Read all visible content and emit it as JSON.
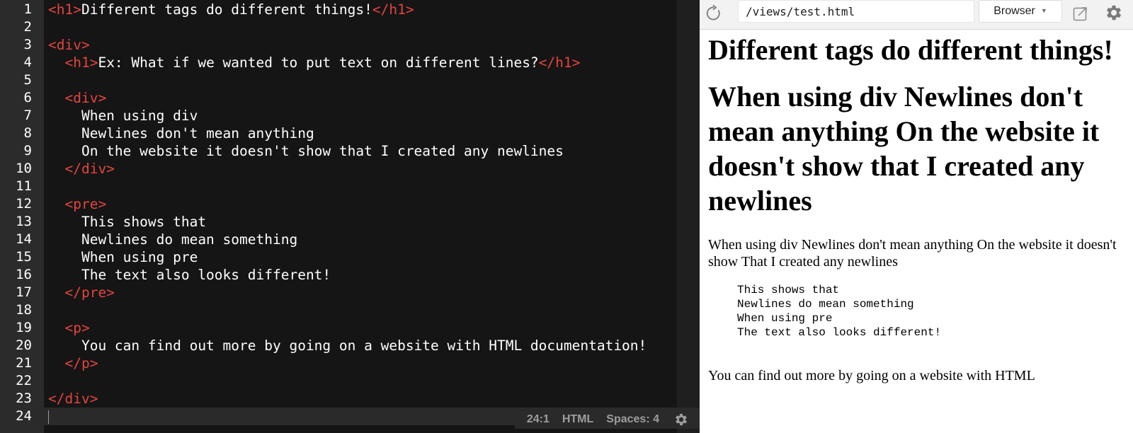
{
  "editor": {
    "lines": [
      {
        "num": "1",
        "parts": [
          [
            "tag",
            "<h1>"
          ],
          [
            "text",
            "Different tags do different things!"
          ],
          [
            "tag",
            "</h1>"
          ]
        ]
      },
      {
        "num": "2",
        "parts": []
      },
      {
        "num": "3",
        "parts": [
          [
            "tag",
            "<div>"
          ]
        ]
      },
      {
        "num": "4",
        "parts": [
          [
            "text",
            "  "
          ],
          [
            "tag",
            "<h1>"
          ],
          [
            "text",
            "Ex: What if we wanted to put text on different lines?"
          ],
          [
            "tag",
            "</h1>"
          ]
        ]
      },
      {
        "num": "5",
        "parts": []
      },
      {
        "num": "6",
        "parts": [
          [
            "text",
            "  "
          ],
          [
            "tag",
            "<div>"
          ]
        ]
      },
      {
        "num": "7",
        "parts": [
          [
            "text",
            "    When using div"
          ]
        ]
      },
      {
        "num": "8",
        "parts": [
          [
            "text",
            "    Newlines don't mean anything"
          ]
        ]
      },
      {
        "num": "9",
        "parts": [
          [
            "text",
            "    On the website it doesn't show that I created any newlines"
          ]
        ]
      },
      {
        "num": "10",
        "parts": [
          [
            "text",
            "  "
          ],
          [
            "tag",
            "</div>"
          ]
        ]
      },
      {
        "num": "11",
        "parts": []
      },
      {
        "num": "12",
        "parts": [
          [
            "text",
            "  "
          ],
          [
            "tag",
            "<pre>"
          ]
        ]
      },
      {
        "num": "13",
        "parts": [
          [
            "text",
            "    This shows that"
          ]
        ]
      },
      {
        "num": "14",
        "parts": [
          [
            "text",
            "    Newlines do mean something"
          ]
        ]
      },
      {
        "num": "15",
        "parts": [
          [
            "text",
            "    When using pre"
          ]
        ]
      },
      {
        "num": "16",
        "parts": [
          [
            "text",
            "    The text also looks different!"
          ]
        ]
      },
      {
        "num": "17",
        "parts": [
          [
            "text",
            "  "
          ],
          [
            "tag",
            "</pre>"
          ]
        ]
      },
      {
        "num": "18",
        "parts": []
      },
      {
        "num": "19",
        "parts": [
          [
            "text",
            "  "
          ],
          [
            "tag",
            "<p>"
          ]
        ]
      },
      {
        "num": "20",
        "parts": [
          [
            "text",
            "    You can find out more by going on a website with HTML documentation!"
          ]
        ]
      },
      {
        "num": "21",
        "parts": [
          [
            "text",
            "  "
          ],
          [
            "tag",
            "</p>"
          ]
        ]
      },
      {
        "num": "22",
        "parts": []
      },
      {
        "num": "23",
        "parts": [
          [
            "tag",
            "</div>"
          ]
        ]
      },
      {
        "num": "24",
        "parts": [],
        "active": true
      }
    ],
    "status": {
      "cursor_pos": "24:1",
      "language": "HTML",
      "spaces": "Spaces: 4",
      "settings_icon": "gear-icon"
    },
    "colors": {
      "tag": "#e2453d",
      "text": "#ffffff",
      "background": "#151515"
    }
  },
  "preview": {
    "toolbar": {
      "reload_icon": "reload-icon",
      "url": "/views/test.html",
      "browser_label": "Browser",
      "popout_icon": "popout-icon",
      "settings_icon": "gear-icon"
    },
    "page": {
      "heading1": "Different tags do different things!",
      "heading2": "When using div Newlines don't mean anything On the website it doesn't show that I created any newlines",
      "div_text": "When using div Newlines don't mean anything On the website it doesn't show That I created any newlines",
      "pre_text": "This shows that\nNewlines do mean something\nWhen using pre\nThe text also looks different!",
      "paragraph": "You can find out more by going on a website with HTML"
    }
  }
}
